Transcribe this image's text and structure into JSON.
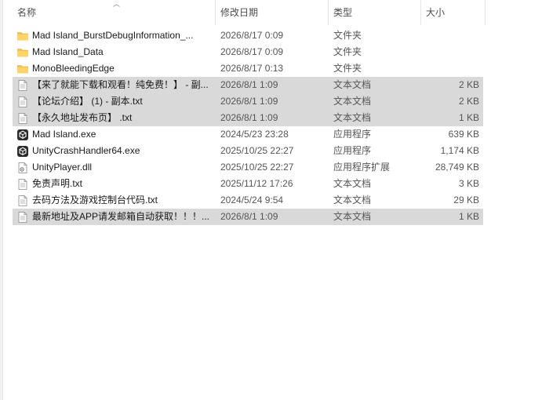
{
  "columns": {
    "name": "名称",
    "modified": "修改日期",
    "type": "类型",
    "size": "大小"
  },
  "files": [
    {
      "icon": "folder-icon",
      "name": "Mad Island_BurstDebugInformation_...",
      "modified": "2026/8/17 0:09",
      "type": "文件夹",
      "size": "",
      "selected": false
    },
    {
      "icon": "folder-icon",
      "name": "Mad Island_Data",
      "modified": "2026/8/17 0:09",
      "type": "文件夹",
      "size": "",
      "selected": false
    },
    {
      "icon": "folder-icon",
      "name": "MonoBleedingEdge",
      "modified": "2026/8/17 0:13",
      "type": "文件夹",
      "size": "",
      "selected": false
    },
    {
      "icon": "text-document-icon",
      "name": "【来了就能下载和观看！纯免费！】 - 副...",
      "modified": "2026/8/1 1:09",
      "type": "文本文档",
      "size": "2 KB",
      "selected": true
    },
    {
      "icon": "text-document-icon",
      "name": "【论坛介绍】 (1) - 副本.txt",
      "modified": "2026/8/1 1:09",
      "type": "文本文档",
      "size": "2 KB",
      "selected": true
    },
    {
      "icon": "text-document-icon",
      "name": "【永久地址发布页】 .txt",
      "modified": "2026/8/1 1:09",
      "type": "文本文档",
      "size": "1 KB",
      "selected": true
    },
    {
      "icon": "unity-app-icon",
      "name": "Mad Island.exe",
      "modified": "2024/5/23 23:28",
      "type": "应用程序",
      "size": "639 KB",
      "selected": false
    },
    {
      "icon": "unity-app-icon",
      "name": "UnityCrashHandler64.exe",
      "modified": "2025/10/25 22:27",
      "type": "应用程序",
      "size": "1,174 KB",
      "selected": false
    },
    {
      "icon": "dll-file-icon",
      "name": "UnityPlayer.dll",
      "modified": "2025/10/25 22:27",
      "type": "应用程序扩展",
      "size": "28,749 KB",
      "selected": false
    },
    {
      "icon": "text-document-icon",
      "name": "免责声明.txt",
      "modified": "2025/11/12 17:26",
      "type": "文本文档",
      "size": "3 KB",
      "selected": false
    },
    {
      "icon": "text-document-icon",
      "name": "去码方法及游戏控制台代码.txt",
      "modified": "2024/5/24 9:54",
      "type": "文本文档",
      "size": "29 KB",
      "selected": false
    },
    {
      "icon": "text-document-icon",
      "name": "最新地址及APP请发邮箱自动获取！！！...",
      "modified": "2026/8/1 1:09",
      "type": "文本文档",
      "size": "1 KB",
      "selected": true
    }
  ]
}
